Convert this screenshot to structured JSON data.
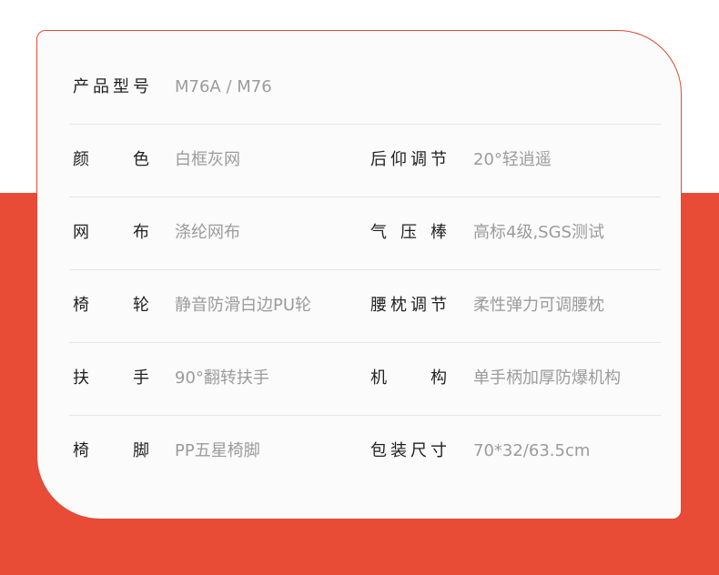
{
  "specs": {
    "rows": [
      {
        "left": {
          "label": "产品型号",
          "value": "M76A / M76"
        }
      },
      {
        "left": {
          "label": "颜色",
          "value": "白框灰网"
        },
        "right": {
          "label": "后仰调节",
          "value": "20°轻逍遥"
        }
      },
      {
        "left": {
          "label": "网布",
          "value": "涤纶网布"
        },
        "right": {
          "label": "气压棒",
          "value": "高标4级,SGS测试"
        }
      },
      {
        "left": {
          "label": "椅轮",
          "value": "静音防滑白边PU轮"
        },
        "right": {
          "label": "腰枕调节",
          "value": "柔性弹力可调腰枕"
        }
      },
      {
        "left": {
          "label": "扶手",
          "value": "90°翻转扶手"
        },
        "right": {
          "label": "机构",
          "value": "单手柄加厚防爆机构"
        }
      },
      {
        "left": {
          "label": "椅脚",
          "value": "PP五星椅脚"
        },
        "right": {
          "label": "包装尺寸",
          "value": "70*32/63.5cm"
        }
      }
    ]
  },
  "colors": {
    "accent": "#e84c37",
    "label": "#1f1f1f",
    "value": "#9b9b9b"
  }
}
